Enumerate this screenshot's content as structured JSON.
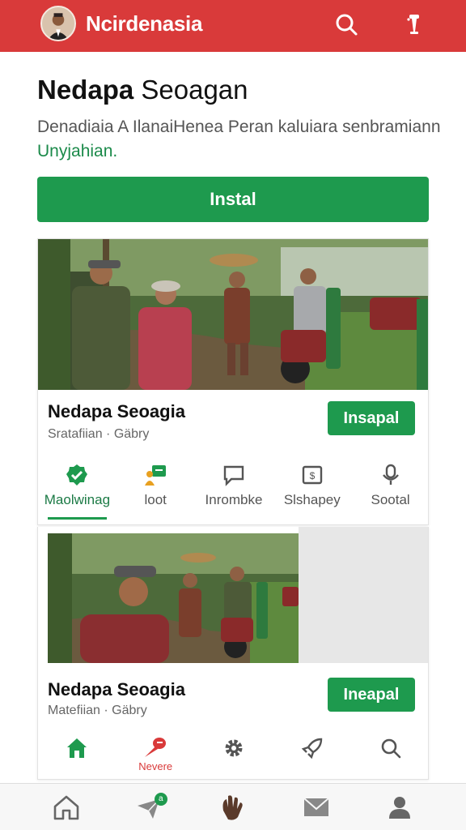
{
  "header": {
    "app_title": "Ncirdenasia",
    "icons": [
      "avatar",
      "search-icon",
      "microphone-icon"
    ],
    "color": "#d93a3a"
  },
  "hero": {
    "title_bold": "Nedapa",
    "title_rest": " Seoagan",
    "description": "Denadiaia A IlanaiHenea Peran kaluiara senbramiann ",
    "description_link": "Unyjahian.",
    "install_label": "Instal"
  },
  "card1": {
    "name": "Nedapa Seoagia",
    "sub": "Sratafiian · Gäbry",
    "button": "Insapal",
    "tabs": [
      {
        "label": "Maolwinag",
        "icon": "verified-badge-icon",
        "active": true
      },
      {
        "label": "loot",
        "icon": "chat-person-icon",
        "active": false
      },
      {
        "label": "Inrombke",
        "icon": "message-icon",
        "active": false
      },
      {
        "label": "Slshapey",
        "icon": "dollar-frame-icon",
        "active": false
      },
      {
        "label": "Sootal",
        "icon": "location-pin-icon",
        "active": false
      }
    ]
  },
  "card2": {
    "name": "Nedapa Seoagia",
    "sub": "Matefiian · Gäbry",
    "button": "Ineapal",
    "nav": [
      {
        "icon": "home-icon",
        "label": ""
      },
      {
        "icon": "megaphone-icon",
        "label": "Nevere"
      },
      {
        "icon": "gear-icon",
        "label": ""
      },
      {
        "icon": "rocket-icon",
        "label": ""
      },
      {
        "icon": "search-icon",
        "label": ""
      }
    ]
  },
  "bottom_nav": [
    {
      "icon": "home-icon"
    },
    {
      "icon": "send-icon",
      "badge": "a"
    },
    {
      "icon": "hand-icon"
    },
    {
      "icon": "mail-icon"
    },
    {
      "icon": "profile-icon"
    }
  ],
  "colors": {
    "accent": "#1e9a4e",
    "header": "#d93a3a"
  }
}
